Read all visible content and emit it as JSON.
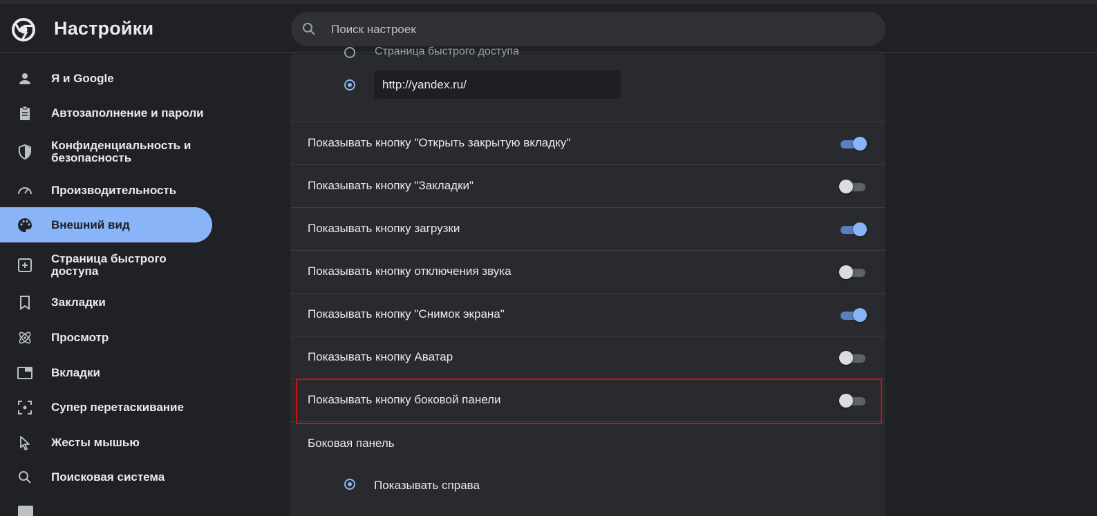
{
  "header": {
    "title": "Настройки",
    "search_placeholder": "Поиск настроек"
  },
  "sidebar": {
    "items": [
      {
        "label": "Я и Google",
        "icon": "person-icon"
      },
      {
        "label": "Автозаполнение и пароли",
        "icon": "clipboard-icon"
      },
      {
        "label": "Конфиденциальность и безопасность",
        "icon": "shield-icon"
      },
      {
        "label": "Производительность",
        "icon": "speedometer-icon"
      },
      {
        "label": "Внешний вид",
        "icon": "palette-icon",
        "active": true
      },
      {
        "label": "Страница быстрого доступа",
        "icon": "add-box-icon"
      },
      {
        "label": "Закладки",
        "icon": "bookmark-icon"
      },
      {
        "label": "Просмотр",
        "icon": "atom-icon"
      },
      {
        "label": "Вкладки",
        "icon": "tab-icon"
      },
      {
        "label": "Супер перетаскивание",
        "icon": "drag-select-icon"
      },
      {
        "label": "Жесты мышью",
        "icon": "cursor-icon"
      },
      {
        "label": "Поисковая система",
        "icon": "search-icon"
      }
    ]
  },
  "main": {
    "startup_cut_label": "Страница быстрого доступа",
    "custom_url": "http://yandex.ru/",
    "toggles": [
      {
        "label": "Показывать кнопку \"Открыть закрытую вкладку\"",
        "on": true
      },
      {
        "label": "Показывать кнопку \"Закладки\"",
        "on": false
      },
      {
        "label": "Показывать кнопку загрузки",
        "on": true
      },
      {
        "label": "Показывать кнопку отключения звука",
        "on": false
      },
      {
        "label": "Показывать кнопку \"Снимок экрана\"",
        "on": true
      },
      {
        "label": "Показывать кнопку Аватар",
        "on": false
      },
      {
        "label": "Показывать кнопку боковой панели",
        "on": false,
        "highlighted": true
      }
    ],
    "side_panel_section": "Боковая панель",
    "side_panel_option": "Показывать справа"
  },
  "colors": {
    "accent": "#8ab4f8",
    "background": "#202124",
    "panel": "#292a2d",
    "highlight_border": "#d01010"
  }
}
